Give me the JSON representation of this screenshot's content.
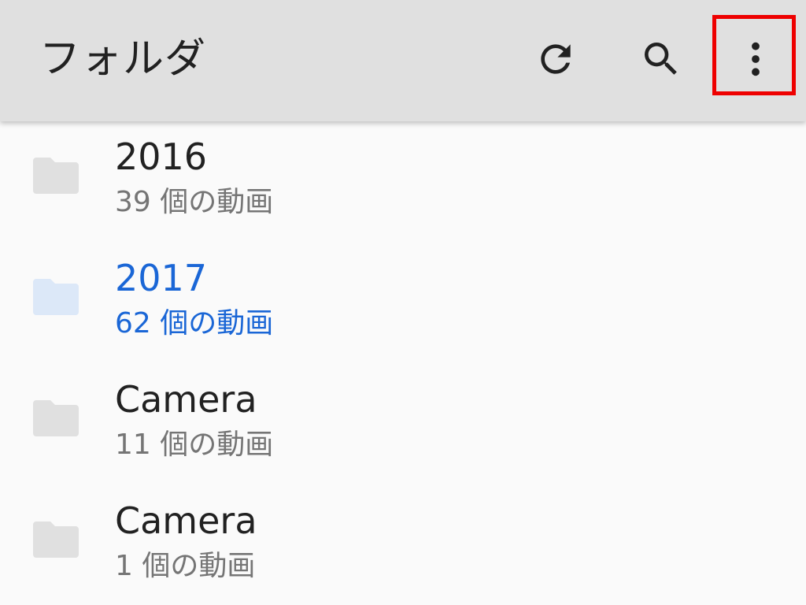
{
  "toolbar": {
    "title": "フォルダ",
    "refresh_icon": "refresh-icon",
    "search_icon": "search-icon",
    "more_icon": "more-vert-icon",
    "highlight_color": "#ee0000"
  },
  "folders": [
    {
      "name": "2016",
      "count": "39 個の動画",
      "selected": false
    },
    {
      "name": "2017",
      "count": "62 個の動画",
      "selected": true
    },
    {
      "name": "Camera",
      "count": "11 個の動画",
      "selected": false
    },
    {
      "name": "Camera",
      "count": "1 個の動画",
      "selected": false
    }
  ],
  "colors": {
    "toolbar_bg": "#e0e0e0",
    "list_bg": "#fafafa",
    "selected_text": "#1a66d6",
    "folder_icon": "#e0e0e0",
    "folder_icon_selected": "#dce8f8"
  }
}
